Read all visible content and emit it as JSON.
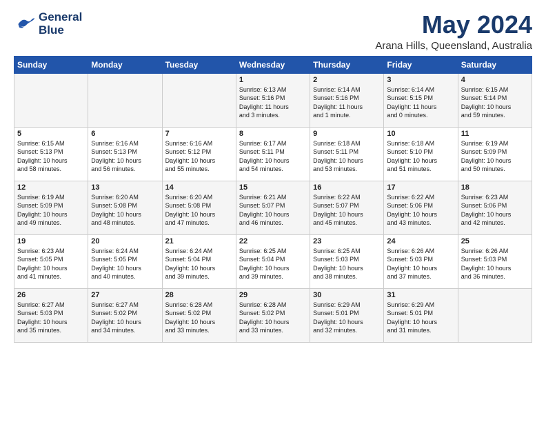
{
  "logo": {
    "line1": "General",
    "line2": "Blue"
  },
  "title": "May 2024",
  "location": "Arana Hills, Queensland, Australia",
  "days_header": [
    "Sunday",
    "Monday",
    "Tuesday",
    "Wednesday",
    "Thursday",
    "Friday",
    "Saturday"
  ],
  "weeks": [
    [
      {
        "num": "",
        "info": ""
      },
      {
        "num": "",
        "info": ""
      },
      {
        "num": "",
        "info": ""
      },
      {
        "num": "1",
        "info": "Sunrise: 6:13 AM\nSunset: 5:16 PM\nDaylight: 11 hours\nand 3 minutes."
      },
      {
        "num": "2",
        "info": "Sunrise: 6:14 AM\nSunset: 5:16 PM\nDaylight: 11 hours\nand 1 minute."
      },
      {
        "num": "3",
        "info": "Sunrise: 6:14 AM\nSunset: 5:15 PM\nDaylight: 11 hours\nand 0 minutes."
      },
      {
        "num": "4",
        "info": "Sunrise: 6:15 AM\nSunset: 5:14 PM\nDaylight: 10 hours\nand 59 minutes."
      }
    ],
    [
      {
        "num": "5",
        "info": "Sunrise: 6:15 AM\nSunset: 5:13 PM\nDaylight: 10 hours\nand 58 minutes."
      },
      {
        "num": "6",
        "info": "Sunrise: 6:16 AM\nSunset: 5:13 PM\nDaylight: 10 hours\nand 56 minutes."
      },
      {
        "num": "7",
        "info": "Sunrise: 6:16 AM\nSunset: 5:12 PM\nDaylight: 10 hours\nand 55 minutes."
      },
      {
        "num": "8",
        "info": "Sunrise: 6:17 AM\nSunset: 5:11 PM\nDaylight: 10 hours\nand 54 minutes."
      },
      {
        "num": "9",
        "info": "Sunrise: 6:18 AM\nSunset: 5:11 PM\nDaylight: 10 hours\nand 53 minutes."
      },
      {
        "num": "10",
        "info": "Sunrise: 6:18 AM\nSunset: 5:10 PM\nDaylight: 10 hours\nand 51 minutes."
      },
      {
        "num": "11",
        "info": "Sunrise: 6:19 AM\nSunset: 5:09 PM\nDaylight: 10 hours\nand 50 minutes."
      }
    ],
    [
      {
        "num": "12",
        "info": "Sunrise: 6:19 AM\nSunset: 5:09 PM\nDaylight: 10 hours\nand 49 minutes."
      },
      {
        "num": "13",
        "info": "Sunrise: 6:20 AM\nSunset: 5:08 PM\nDaylight: 10 hours\nand 48 minutes."
      },
      {
        "num": "14",
        "info": "Sunrise: 6:20 AM\nSunset: 5:08 PM\nDaylight: 10 hours\nand 47 minutes."
      },
      {
        "num": "15",
        "info": "Sunrise: 6:21 AM\nSunset: 5:07 PM\nDaylight: 10 hours\nand 46 minutes."
      },
      {
        "num": "16",
        "info": "Sunrise: 6:22 AM\nSunset: 5:07 PM\nDaylight: 10 hours\nand 45 minutes."
      },
      {
        "num": "17",
        "info": "Sunrise: 6:22 AM\nSunset: 5:06 PM\nDaylight: 10 hours\nand 43 minutes."
      },
      {
        "num": "18",
        "info": "Sunrise: 6:23 AM\nSunset: 5:06 PM\nDaylight: 10 hours\nand 42 minutes."
      }
    ],
    [
      {
        "num": "19",
        "info": "Sunrise: 6:23 AM\nSunset: 5:05 PM\nDaylight: 10 hours\nand 41 minutes."
      },
      {
        "num": "20",
        "info": "Sunrise: 6:24 AM\nSunset: 5:05 PM\nDaylight: 10 hours\nand 40 minutes."
      },
      {
        "num": "21",
        "info": "Sunrise: 6:24 AM\nSunset: 5:04 PM\nDaylight: 10 hours\nand 39 minutes."
      },
      {
        "num": "22",
        "info": "Sunrise: 6:25 AM\nSunset: 5:04 PM\nDaylight: 10 hours\nand 39 minutes."
      },
      {
        "num": "23",
        "info": "Sunrise: 6:25 AM\nSunset: 5:03 PM\nDaylight: 10 hours\nand 38 minutes."
      },
      {
        "num": "24",
        "info": "Sunrise: 6:26 AM\nSunset: 5:03 PM\nDaylight: 10 hours\nand 37 minutes."
      },
      {
        "num": "25",
        "info": "Sunrise: 6:26 AM\nSunset: 5:03 PM\nDaylight: 10 hours\nand 36 minutes."
      }
    ],
    [
      {
        "num": "26",
        "info": "Sunrise: 6:27 AM\nSunset: 5:03 PM\nDaylight: 10 hours\nand 35 minutes."
      },
      {
        "num": "27",
        "info": "Sunrise: 6:27 AM\nSunset: 5:02 PM\nDaylight: 10 hours\nand 34 minutes."
      },
      {
        "num": "28",
        "info": "Sunrise: 6:28 AM\nSunset: 5:02 PM\nDaylight: 10 hours\nand 33 minutes."
      },
      {
        "num": "29",
        "info": "Sunrise: 6:28 AM\nSunset: 5:02 PM\nDaylight: 10 hours\nand 33 minutes."
      },
      {
        "num": "30",
        "info": "Sunrise: 6:29 AM\nSunset: 5:01 PM\nDaylight: 10 hours\nand 32 minutes."
      },
      {
        "num": "31",
        "info": "Sunrise: 6:29 AM\nSunset: 5:01 PM\nDaylight: 10 hours\nand 31 minutes."
      },
      {
        "num": "",
        "info": ""
      }
    ]
  ]
}
